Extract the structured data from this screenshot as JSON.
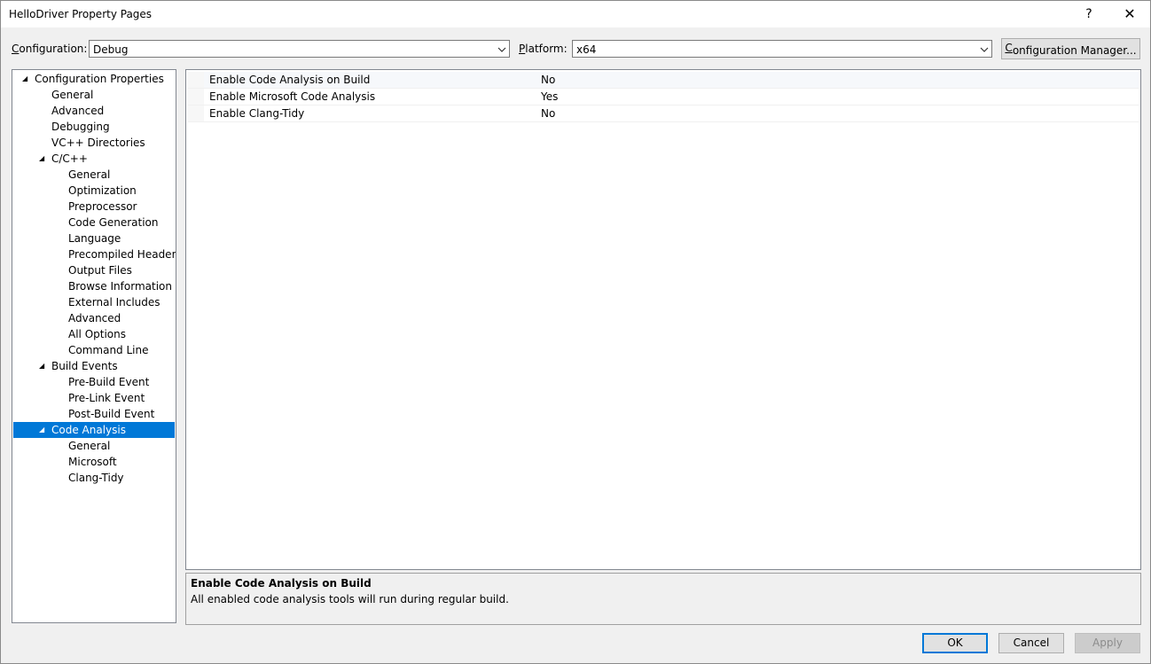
{
  "window": {
    "title": "HelloDriver Property Pages",
    "help_glyph": "?",
    "close_glyph": "✕"
  },
  "toolbar": {
    "configuration_label_mnemonic": "C",
    "configuration_label_rest": "onfiguration:",
    "configuration_value": "Debug",
    "platform_label_mnemonic": "P",
    "platform_label_rest": "latform:",
    "platform_value": "x64",
    "config_manager_mnemonic": "C",
    "config_manager_rest": "onfiguration Manager..."
  },
  "tree": {
    "items": [
      {
        "label": "Configuration Properties",
        "expander": "◢"
      },
      {
        "label": "General"
      },
      {
        "label": "Advanced"
      },
      {
        "label": "Debugging"
      },
      {
        "label": "VC++ Directories"
      },
      {
        "label": "C/C++",
        "expander": "◢"
      },
      {
        "label": "General"
      },
      {
        "label": "Optimization"
      },
      {
        "label": "Preprocessor"
      },
      {
        "label": "Code Generation"
      },
      {
        "label": "Language"
      },
      {
        "label": "Precompiled Headers"
      },
      {
        "label": "Output Files"
      },
      {
        "label": "Browse Information"
      },
      {
        "label": "External Includes"
      },
      {
        "label": "Advanced"
      },
      {
        "label": "All Options"
      },
      {
        "label": "Command Line"
      },
      {
        "label": "Build Events",
        "expander": "◢"
      },
      {
        "label": "Pre-Build Event"
      },
      {
        "label": "Pre-Link Event"
      },
      {
        "label": "Post-Build Event"
      },
      {
        "label": "Code Analysis",
        "expander": "◢",
        "selected": true
      },
      {
        "label": "General"
      },
      {
        "label": "Microsoft"
      },
      {
        "label": "Clang-Tidy"
      }
    ]
  },
  "properties": [
    {
      "name": "Enable Code Analysis on Build",
      "value": "No"
    },
    {
      "name": "Enable Microsoft Code Analysis",
      "value": "Yes"
    },
    {
      "name": "Enable Clang-Tidy",
      "value": "No"
    }
  ],
  "description": {
    "title": "Enable Code Analysis on Build",
    "text": "All enabled code analysis tools will run during regular build."
  },
  "buttons": {
    "ok": "OK",
    "cancel": "Cancel",
    "apply": "Apply"
  },
  "colors": {
    "selection": "#0078d7",
    "window_bg": "#f0f0f0"
  }
}
